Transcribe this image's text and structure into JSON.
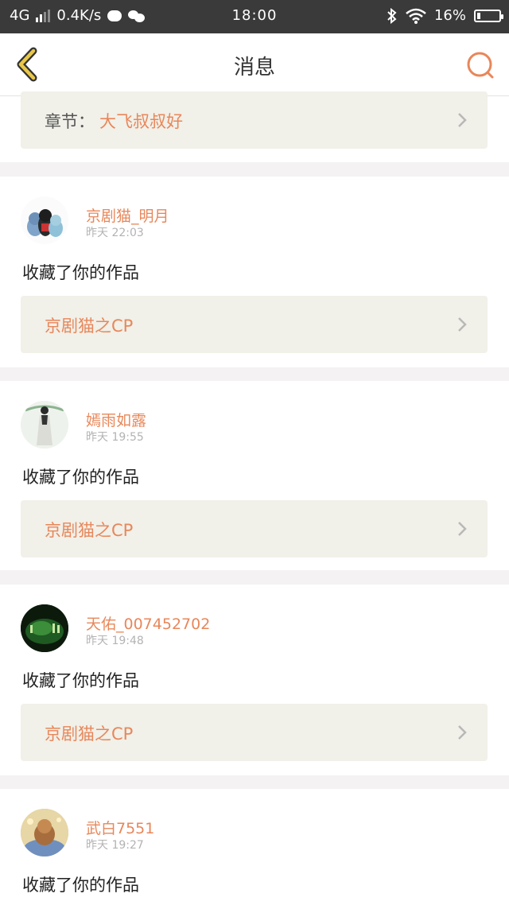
{
  "status_bar": {
    "network": "4G",
    "speed": "0.4K/s",
    "time": "18:00",
    "battery": "16%",
    "battery_level": 0.16
  },
  "header": {
    "title": "消息"
  },
  "top_card": {
    "chapter_prefix": "章节：",
    "chapter_name": "大飞叔叔好"
  },
  "messages": [
    {
      "username": "京剧猫_明月",
      "time": "昨天 22:03",
      "action": "收藏了你的作品",
      "target": "京剧猫之CP"
    },
    {
      "username": "嫣雨如露",
      "time": "昨天 19:55",
      "action": "收藏了你的作品",
      "target": "京剧猫之CP"
    },
    {
      "username": "天佑_007452702",
      "time": "昨天 19:48",
      "action": "收藏了你的作品",
      "target": "京剧猫之CP"
    },
    {
      "username": "武白7551",
      "time": "昨天 19:27",
      "action": "收藏了你的作品"
    }
  ],
  "colors": {
    "accent": "#e8875a",
    "card_bg": "#f1f0e9",
    "separator": "#f4f2f2",
    "back_icon": "#e8c84a"
  },
  "icons": {
    "back": "chevron-left-icon",
    "search": "search-icon",
    "row_chevron": "chevron-right-icon"
  }
}
